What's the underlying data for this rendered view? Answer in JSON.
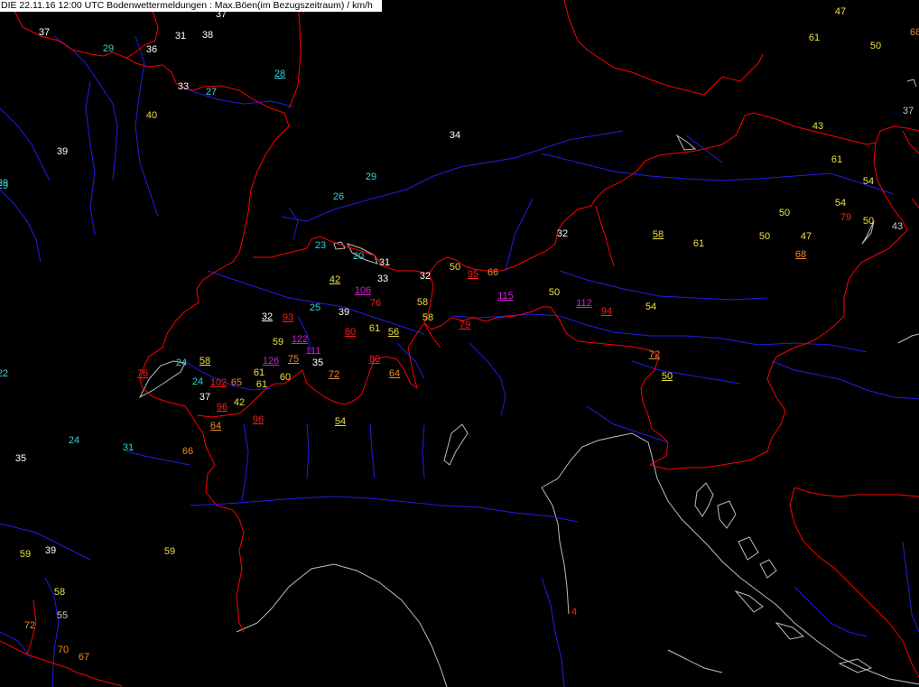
{
  "title": "DIE 22.11.16 12:00 UTC  Bodenwettermeldungen :  Max.Böen(im Bezugszeitraum) / km/h",
  "map": {
    "colors": {
      "border": "#ff0000",
      "river": "#1e1ee6",
      "coast": "#bcbcbc",
      "background": "#000000"
    }
  },
  "stations": [
    {
      "v": "37",
      "c": "white",
      "u": false
    },
    {
      "v": "37",
      "c": "white",
      "u": false
    },
    {
      "v": "29",
      "c": "cyan",
      "u": false
    },
    {
      "v": "36",
      "c": "white",
      "u": false
    },
    {
      "v": "31",
      "c": "white",
      "u": false
    },
    {
      "v": "38",
      "c": "white",
      "u": false
    },
    {
      "v": "28",
      "c": "cyan",
      "u": true
    },
    {
      "v": "33",
      "c": "white",
      "u": false
    },
    {
      "v": "27",
      "c": "cyan",
      "u": false
    },
    {
      "v": "40",
      "c": "yellow",
      "u": false
    },
    {
      "v": "39",
      "c": "white",
      "u": false
    },
    {
      "v": "29",
      "c": "cyan",
      "u": false
    },
    {
      "v": "34",
      "c": "white",
      "u": false
    },
    {
      "v": "29",
      "c": "cyan",
      "u": false
    },
    {
      "v": "26",
      "c": "cyan",
      "u": false
    },
    {
      "v": "23",
      "c": "cyan",
      "u": false
    },
    {
      "v": "20",
      "c": "cyan",
      "u": false
    },
    {
      "v": "31",
      "c": "white",
      "u": false
    },
    {
      "v": "33",
      "c": "white",
      "u": false
    },
    {
      "v": "32",
      "c": "white",
      "u": false
    },
    {
      "v": "50",
      "c": "yellow",
      "u": false
    },
    {
      "v": "95",
      "c": "red",
      "u": true
    },
    {
      "v": "66",
      "c": "orange",
      "u": false
    },
    {
      "v": "32",
      "c": "white",
      "u": false
    },
    {
      "v": "42",
      "c": "yellow",
      "u": true
    },
    {
      "v": "106",
      "c": "magenta",
      "u": true
    },
    {
      "v": "76",
      "c": "red",
      "u": false
    },
    {
      "v": "58",
      "c": "yellow",
      "u": false
    },
    {
      "v": "115",
      "c": "magenta",
      "u": true
    },
    {
      "v": "50",
      "c": "yellow",
      "u": false
    },
    {
      "v": "112",
      "c": "magenta",
      "u": true
    },
    {
      "v": "94",
      "c": "red",
      "u": true
    },
    {
      "v": "54",
      "c": "yellow",
      "u": false
    },
    {
      "v": "32",
      "c": "white",
      "u": true
    },
    {
      "v": "93",
      "c": "red",
      "u": true
    },
    {
      "v": "25",
      "c": "cyan",
      "u": false
    },
    {
      "v": "39",
      "c": "white",
      "u": false
    },
    {
      "v": "58",
      "c": "yellow",
      "u": false
    },
    {
      "v": "79",
      "c": "red",
      "u": true
    },
    {
      "v": "80",
      "c": "red",
      "u": true
    },
    {
      "v": "61",
      "c": "yellow",
      "u": false
    },
    {
      "v": "56",
      "c": "yellow",
      "u": true
    },
    {
      "v": "59",
      "c": "yellow",
      "u": false
    },
    {
      "v": "122",
      "c": "magenta",
      "u": true
    },
    {
      "v": "111",
      "c": "magenta",
      "u": false
    },
    {
      "v": "126",
      "c": "magenta",
      "u": true
    },
    {
      "v": "75",
      "c": "orange",
      "u": true
    },
    {
      "v": "35",
      "c": "white",
      "u": false
    },
    {
      "v": "80",
      "c": "red",
      "u": true
    },
    {
      "v": "72",
      "c": "orange",
      "u": true
    },
    {
      "v": "64",
      "c": "orange",
      "u": true
    },
    {
      "v": "76",
      "c": "red",
      "u": true
    },
    {
      "v": "24",
      "c": "cyan",
      "u": false
    },
    {
      "v": "58",
      "c": "yellow",
      "u": true
    },
    {
      "v": "24",
      "c": "cyan",
      "u": false
    },
    {
      "v": "102",
      "c": "red",
      "u": true
    },
    {
      "v": "65",
      "c": "orange",
      "u": false
    },
    {
      "v": "61",
      "c": "yellow",
      "u": false
    },
    {
      "v": "61",
      "c": "yellow",
      "u": false
    },
    {
      "v": "60",
      "c": "yellow",
      "u": false
    },
    {
      "v": "37",
      "c": "white",
      "u": false
    },
    {
      "v": "96",
      "c": "red",
      "u": true
    },
    {
      "v": "42",
      "c": "yellow",
      "u": false
    },
    {
      "v": "64",
      "c": "orange",
      "u": true
    },
    {
      "v": "96",
      "c": "red",
      "u": true
    },
    {
      "v": "54",
      "c": "yellow",
      "u": true
    },
    {
      "v": "22",
      "c": "cyan",
      "u": false
    },
    {
      "v": "29",
      "c": "cyan",
      "u": false
    },
    {
      "v": "24",
      "c": "cyan",
      "u": false
    },
    {
      "v": "31",
      "c": "cyan",
      "u": false
    },
    {
      "v": "35",
      "c": "white",
      "u": false
    },
    {
      "v": "66",
      "c": "orange",
      "u": false
    },
    {
      "v": "59",
      "c": "yellow",
      "u": false
    },
    {
      "v": "39",
      "c": "white",
      "u": false
    },
    {
      "v": "59",
      "c": "yellow",
      "u": false
    },
    {
      "v": "58",
      "c": "yellow",
      "u": false
    },
    {
      "v": "55",
      "c": "grey",
      "u": false
    },
    {
      "v": "72",
      "c": "orange",
      "u": false
    },
    {
      "v": "70",
      "c": "orange",
      "u": false
    },
    {
      "v": "67",
      "c": "orange",
      "u": false
    },
    {
      "v": "4",
      "c": "red",
      "u": false
    },
    {
      "v": "47",
      "c": "yellow",
      "u": false
    },
    {
      "v": "61",
      "c": "yellow",
      "u": false
    },
    {
      "v": "50",
      "c": "yellow",
      "u": false
    },
    {
      "v": "68",
      "c": "orange",
      "u": false
    },
    {
      "v": "37",
      "c": "grey",
      "u": false
    },
    {
      "v": "43",
      "c": "yellow",
      "u": false
    },
    {
      "v": "61",
      "c": "yellow",
      "u": false
    },
    {
      "v": "54",
      "c": "yellow",
      "u": false
    },
    {
      "v": "54",
      "c": "yellow",
      "u": false
    },
    {
      "v": "50",
      "c": "yellow",
      "u": false
    },
    {
      "v": "79",
      "c": "red",
      "u": false
    },
    {
      "v": "50",
      "c": "yellow",
      "u": false
    },
    {
      "v": "43",
      "c": "grey",
      "u": false
    },
    {
      "v": "58",
      "c": "yellow",
      "u": true
    },
    {
      "v": "61",
      "c": "yellow",
      "u": false
    },
    {
      "v": "50",
      "c": "yellow",
      "u": false
    },
    {
      "v": "47",
      "c": "yellow",
      "u": false
    },
    {
      "v": "68",
      "c": "orange",
      "u": true
    },
    {
      "v": "72",
      "c": "orange",
      "u": true
    },
    {
      "v": "50",
      "c": "yellow",
      "u": true
    }
  ]
}
